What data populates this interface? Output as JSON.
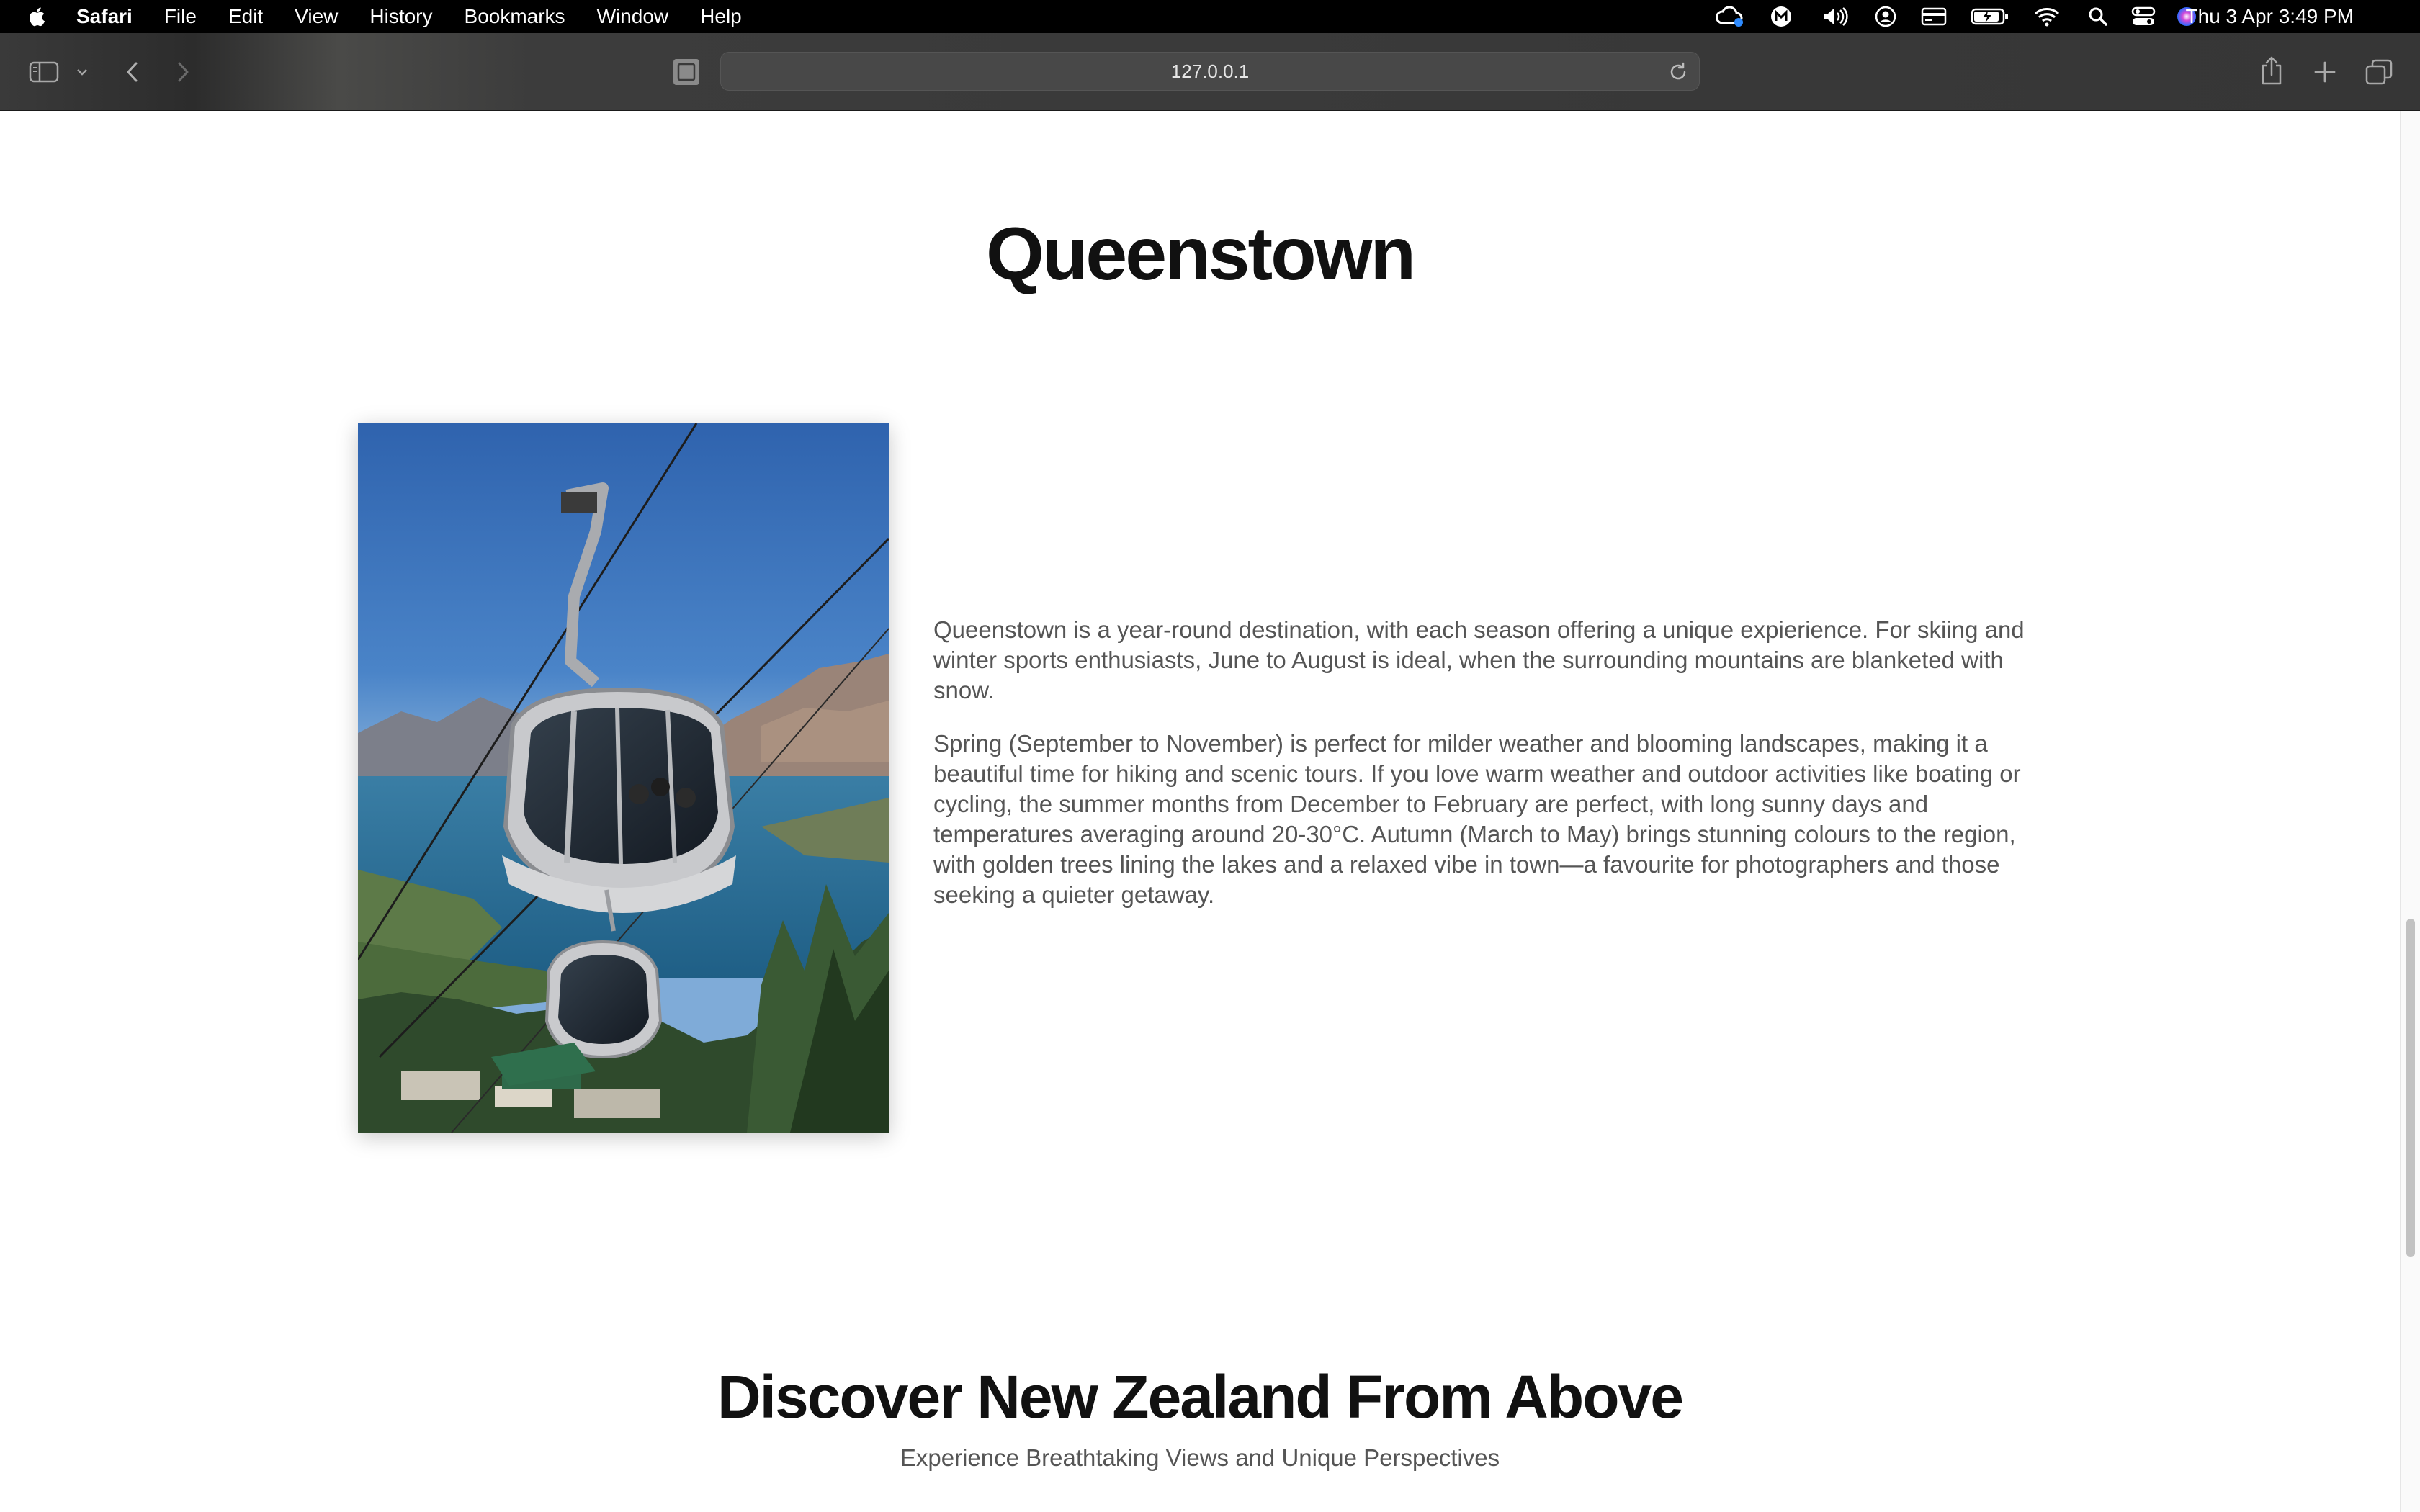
{
  "menubar": {
    "app_name": "Safari",
    "items": [
      "File",
      "Edit",
      "View",
      "History",
      "Bookmarks",
      "Window",
      "Help"
    ],
    "clock": "Thu 3 Apr  3:49 PM"
  },
  "toolbar": {
    "url": "127.0.0.1"
  },
  "page": {
    "title": "Queenstown",
    "paragraphs": [
      "Queenstown is a year-round destination, with each season offering a unique expierience. For skiing and winter sports enthusiasts, June to August is ideal, when the surrounding mountains are blanketed with snow.",
      "Spring (September to November) is perfect for milder weather and blooming landscapes, making it a beautiful time for hiking and scenic tours. If you love warm weather and outdoor activities like boating or cycling, the summer months from December to February are perfect, with long sunny days and temperatures averaging around 20-30°C. Autumn (March to May) brings stunning colours to the region, with golden trees lining the lakes and a relaxed vibe in town—a favourite for photographers and those seeking a quieter getaway."
    ],
    "section_title": "Discover New Zealand From Above",
    "section_subtitle": "Experience Breathtaking Views and Unique Perspectives"
  },
  "scroll": {
    "position_fraction": 0.76
  }
}
